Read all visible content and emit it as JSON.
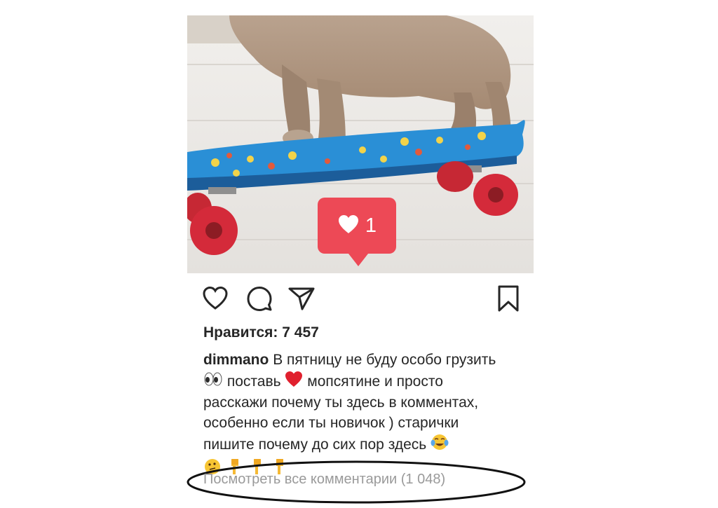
{
  "post": {
    "like_overlay": {
      "count": "1"
    },
    "likes_text": "Нравится: 7 457",
    "caption": {
      "username": "dimmano",
      "line1": "В пятницу не буду особо грузить",
      "line2": "поставь",
      "line2b": "мопсятине и просто",
      "line3": "расскажи почему ты здесь в комментах,",
      "line4": "особенно если ты новичок ) старички",
      "line5": "пишите почему до сих пор  здесь",
      "emoji_row": [
        "eyes",
        "red-heart",
        "face-with-tears-of-joy",
        "thinking-face",
        "backhand-index-pointing-down",
        "backhand-index-pointing-down",
        "backhand-index-pointing-down"
      ]
    },
    "view_comments": "Посмотреть все комментарии (1 048)"
  },
  "icons": {
    "like": "heart-outline-icon",
    "comment": "comment-bubble-icon",
    "share": "paper-plane-icon",
    "save": "bookmark-icon"
  },
  "colors": {
    "notification_red": "#ed4956",
    "text": "#262626",
    "muted": "#9a9a9a",
    "skateboard_blue": "#2a8fd6",
    "wheel_red": "#d42a3a"
  }
}
